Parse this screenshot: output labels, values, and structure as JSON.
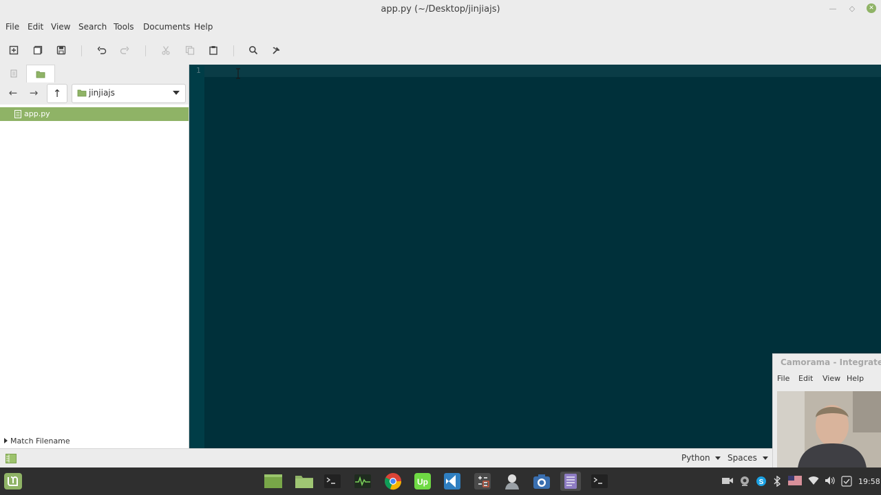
{
  "window": {
    "title": "app.py (~/Desktop/jinjiajs)"
  },
  "menu": {
    "items": [
      "File",
      "Edit",
      "View",
      "Search",
      "Tools",
      "Documents",
      "Help"
    ]
  },
  "toolbar": {
    "icons": [
      "new-document-icon",
      "open-document-icon",
      "save-icon",
      "undo-icon",
      "redo-icon",
      "cut-icon",
      "copy-icon",
      "paste-icon",
      "search-icon",
      "tools-icon"
    ]
  },
  "sidepanel": {
    "folder": "jinjiajs",
    "files": [
      "app.py"
    ],
    "match_filename": "Match Filename"
  },
  "editor": {
    "line_number": "1",
    "content": ""
  },
  "statusbar": {
    "language": "Python",
    "indent": "Spaces"
  },
  "camorama": {
    "title": "Camorama - Integrated",
    "menu": [
      "File",
      "Edit",
      "View",
      "Help"
    ]
  },
  "taskbar": {
    "clock": "19:58"
  },
  "colors": {
    "accent": "#8fb366",
    "editor_bg": "#00303a",
    "taskbar_bg": "#2f2f2f"
  }
}
